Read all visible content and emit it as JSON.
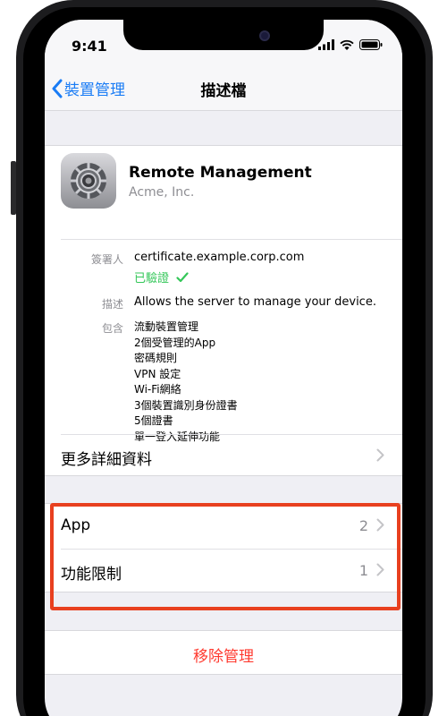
{
  "status_bar": {
    "time": "9:41"
  },
  "nav": {
    "back_label": "裝置管理",
    "title": "描述檔"
  },
  "profile": {
    "name": "Remote Management",
    "organization": "Acme, Inc.",
    "signed_by_label": "簽署人",
    "signed_by_value": "certificate.example.corp.com",
    "verified_text": "已驗證",
    "description_label": "描述",
    "description_value": "Allows the server to manage your device.",
    "contains_label": "包含",
    "contains_items": [
      "流動裝置管理",
      "2個受管理的App",
      "密碼規則",
      "VPN 設定",
      "Wi-Fi網絡",
      "3個裝置識別身份證書",
      "5個證書",
      "單一登入延伸功能"
    ],
    "more_details": "更多詳細資料"
  },
  "group": {
    "rows": [
      {
        "label": "App",
        "count": "2"
      },
      {
        "label": "功能限制",
        "count": "1"
      }
    ]
  },
  "remove": {
    "label": "移除管理"
  },
  "colors": {
    "accent": "#1a7cf5",
    "destructive": "#ff3b30",
    "verified": "#34c759",
    "highlight": "#e8401f"
  },
  "icons": [
    "signal-icon",
    "wifi-icon",
    "battery-icon",
    "back-chevron-icon",
    "settings-gear-icon",
    "checkmark-icon",
    "chevron-right-icon"
  ]
}
